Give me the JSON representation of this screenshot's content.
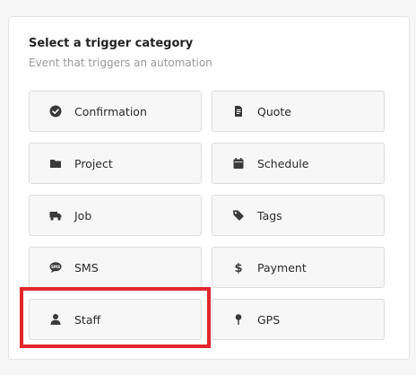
{
  "panel": {
    "title": "Select a trigger category",
    "subtitle": "Event that triggers an automation"
  },
  "categories": [
    {
      "label": "Confirmation",
      "icon": "check-circle-icon"
    },
    {
      "label": "Quote",
      "icon": "document-icon"
    },
    {
      "label": "Project",
      "icon": "folder-icon"
    },
    {
      "label": "Schedule",
      "icon": "calendar-icon"
    },
    {
      "label": "Job",
      "icon": "truck-icon"
    },
    {
      "label": "Tags",
      "icon": "tag-icon"
    },
    {
      "label": "SMS",
      "icon": "sms-bubble-icon"
    },
    {
      "label": "Payment",
      "icon": "dollar-icon"
    },
    {
      "label": "Staff",
      "icon": "person-icon"
    },
    {
      "label": "GPS",
      "icon": "pin-icon"
    }
  ],
  "highlight": {
    "target": "Staff",
    "color": "#e1272b"
  }
}
